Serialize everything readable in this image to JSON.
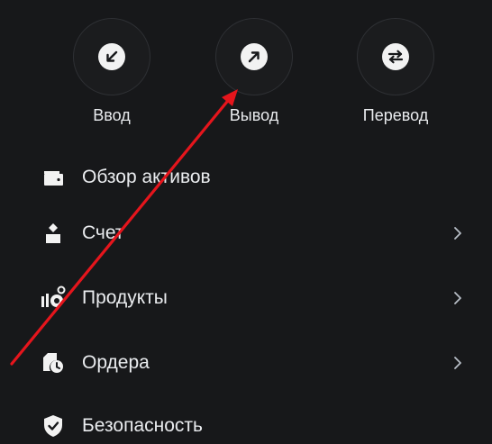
{
  "actions": [
    {
      "label": "Ввод",
      "icon": "arrow-down-left-icon"
    },
    {
      "label": "Вывод",
      "icon": "arrow-up-right-icon"
    },
    {
      "label": "Перевод",
      "icon": "transfer-arrows-icon"
    }
  ],
  "menu": {
    "items": [
      {
        "label": "Обзор активов",
        "icon": "wallet-icon",
        "has_chevron": false
      },
      {
        "label": "Счет",
        "icon": "account-icon",
        "has_chevron": true
      },
      {
        "label": "Продукты",
        "icon": "products-icon",
        "has_chevron": true
      },
      {
        "label": "Ордера",
        "icon": "orders-clock-icon",
        "has_chevron": true
      },
      {
        "label": "Безопасность",
        "icon": "shield-check-icon",
        "has_chevron": false
      }
    ]
  },
  "colors": {
    "background": "#17181a",
    "text": "#eaecef",
    "circle_border": "#2e3034",
    "icon_fill": "#f2f2f2",
    "chevron": "#b7bdc6",
    "annotation_arrow": "#e5151c"
  }
}
